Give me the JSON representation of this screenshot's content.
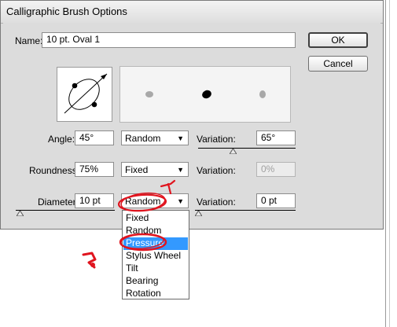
{
  "dialog": {
    "title": "Calligraphic Brush Options",
    "name_label": "Name:",
    "name_value": "10 pt. Oval 1",
    "ok_label": "OK",
    "cancel_label": "Cancel"
  },
  "rows": {
    "angle": {
      "label": "Angle:",
      "value": "45°",
      "mode": "Random",
      "variation_label": "Variation:",
      "variation_value": "65°"
    },
    "roundness": {
      "label": "Roundness:",
      "value": "75%",
      "mode": "Fixed",
      "variation_label": "Variation:",
      "variation_value": "0%"
    },
    "diameter": {
      "label": "Diameter:",
      "value": "10 pt",
      "mode": "Random",
      "variation_label": "Variation:",
      "variation_value": "0 pt"
    }
  },
  "dropdown": {
    "options": [
      "Fixed",
      "Random",
      "Pressure",
      "Stylus Wheel",
      "Tilt",
      "Bearing",
      "Rotation"
    ],
    "highlighted": "Pressure"
  },
  "colors": {
    "highlight": "#3399ff",
    "annotation": "#e0141e",
    "dialog_bg": "#dcdcdc"
  },
  "icons": [
    "dropdown-arrow-icon",
    "brush-shape-icon",
    "slider-thumb-icon"
  ]
}
